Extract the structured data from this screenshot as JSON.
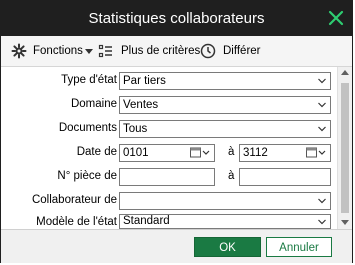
{
  "window": {
    "title": "Statistiques collaborateurs"
  },
  "toolbar": {
    "functions_label": "Fonctions",
    "more_criteria_label": "Plus de critères",
    "defer_label": "Différer"
  },
  "form": {
    "report_type": {
      "label": "Type d'état",
      "value": "Par tiers"
    },
    "domain": {
      "label": "Domaine",
      "value": "Ventes"
    },
    "documents": {
      "label": "Documents",
      "value": "Tous"
    },
    "date": {
      "label": "Date de",
      "from": "0101",
      "to_label": "à",
      "to": "3112"
    },
    "piece_number": {
      "label": "N° pièce de",
      "from": "",
      "to_label": "à",
      "to": ""
    },
    "employee": {
      "label": "Collaborateur de",
      "value": ""
    },
    "report_model": {
      "label": "Modèle de l'état",
      "value": "Standard"
    }
  },
  "buttons": {
    "ok": "OK",
    "cancel": "Annuler"
  },
  "colors": {
    "titlebar": "#1f1f1f",
    "accent": "#1a7a43",
    "close_icon": "#2ecc71"
  }
}
